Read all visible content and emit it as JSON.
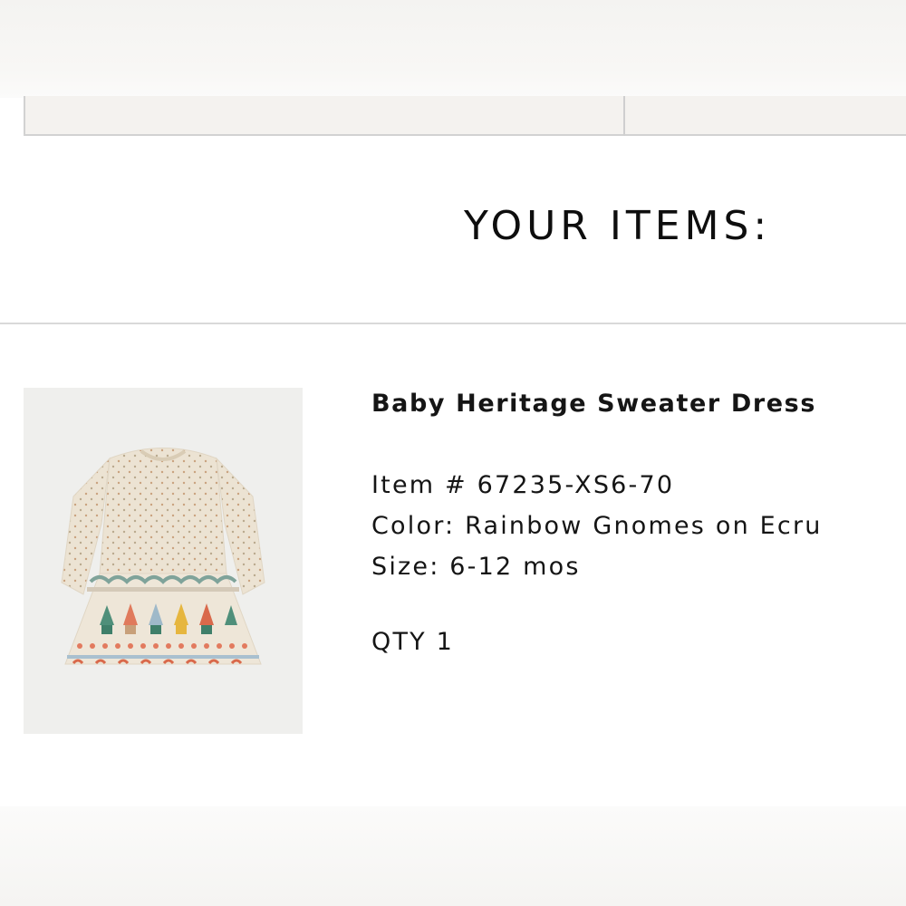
{
  "header": {
    "tabs": [
      "",
      ""
    ]
  },
  "section": {
    "title": "YOUR ITEMS:"
  },
  "item": {
    "name": "Baby Heritage Sweater Dress",
    "item_number": "Item # 67235-XS6-70",
    "color": "Color: Rainbow Gnomes on Ecru",
    "size": "Size: 6-12 mos",
    "quantity": "QTY 1"
  },
  "colors": {
    "background": "#ffffff",
    "text": "#111111",
    "divider": "#d9d9d9",
    "sweater": "#ece3d3"
  }
}
